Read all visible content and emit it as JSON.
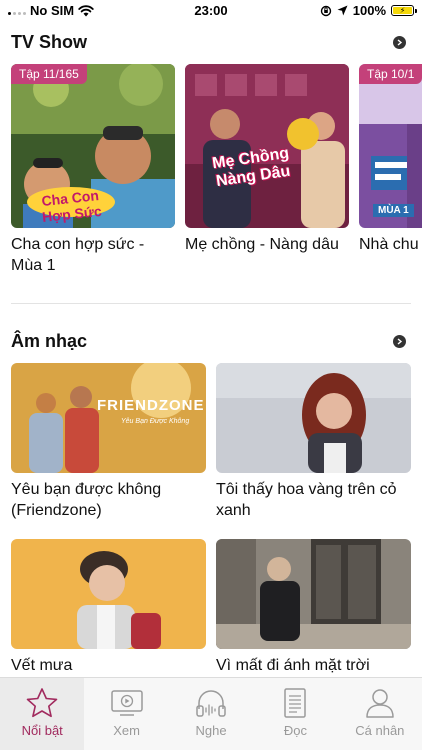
{
  "status": {
    "carrier": "No SIM",
    "time": "23:00",
    "battery": "100%"
  },
  "tv_section": {
    "title": "TV Show",
    "cards": [
      {
        "episode": "Tập 11/165",
        "title": "Cha con hợp sức - Mùa 1",
        "logo": "Cha Con Hợp Sức"
      },
      {
        "episode": "",
        "title": "Mẹ chồng - Nàng dâu",
        "logo": "Mẹ Chồng Nàng Dâu"
      },
      {
        "episode": "Tập 10/1",
        "title": "Nhà chu",
        "sub": "MÙA 1"
      }
    ]
  },
  "music_section": {
    "title": "Âm nhạc",
    "cards": [
      {
        "title": "Yêu bạn được không (Friendzone)",
        "banner": "FRIENDZONE",
        "banner_sub": "Yêu Bạn Được Không"
      },
      {
        "title": "Tôi thấy hoa vàng trên cỏ xanh"
      },
      {
        "title": "Vết mưa"
      },
      {
        "title": "Vì mất đi ánh mặt trời"
      }
    ]
  },
  "tabs": [
    {
      "label": "Nổi bật",
      "icon": "star-icon",
      "active": true
    },
    {
      "label": "Xem",
      "icon": "tv-play-icon",
      "active": false
    },
    {
      "label": "Nghe",
      "icon": "headphones-icon",
      "active": false
    },
    {
      "label": "Đọc",
      "icon": "document-icon",
      "active": false
    },
    {
      "label": "Cá nhân",
      "icon": "person-icon",
      "active": false
    }
  ],
  "colors": {
    "accent": "#a12a5e",
    "badge": "#c4417a",
    "tab_inactive": "#9a9a9a"
  }
}
